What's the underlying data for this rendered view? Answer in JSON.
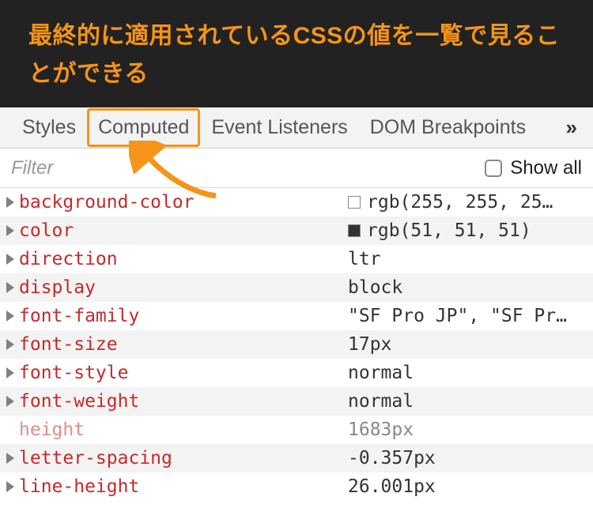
{
  "annotation": {
    "text": "最終的に適用されているCSSの値を一覧で見ることができる"
  },
  "tabs": {
    "styles": "Styles",
    "computed": "Computed",
    "eventListeners": "Event Listeners",
    "domBreakpoints": "DOM Breakpoints",
    "overflow": "»"
  },
  "filter": {
    "placeholder": "Filter",
    "showAllLabel": "Show all"
  },
  "properties": [
    {
      "name": "background-color",
      "value": "rgb(255, 255, 25…",
      "swatch": "#ffffff",
      "expandable": true
    },
    {
      "name": "color",
      "value": "rgb(51, 51, 51)",
      "swatch": "#333333",
      "expandable": true
    },
    {
      "name": "direction",
      "value": "ltr",
      "expandable": true
    },
    {
      "name": "display",
      "value": "block",
      "expandable": true
    },
    {
      "name": "font-family",
      "value": "\"SF Pro JP\", \"SF Pr…",
      "expandable": true
    },
    {
      "name": "font-size",
      "value": "17px",
      "expandable": true
    },
    {
      "name": "font-style",
      "value": "normal",
      "expandable": true
    },
    {
      "name": "font-weight",
      "value": "normal",
      "expandable": true
    },
    {
      "name": "height",
      "value": "1683px",
      "expandable": false,
      "dim": true
    },
    {
      "name": "letter-spacing",
      "value": "-0.357px",
      "expandable": true
    },
    {
      "name": "line-height",
      "value": "26.001px",
      "expandable": true
    }
  ]
}
